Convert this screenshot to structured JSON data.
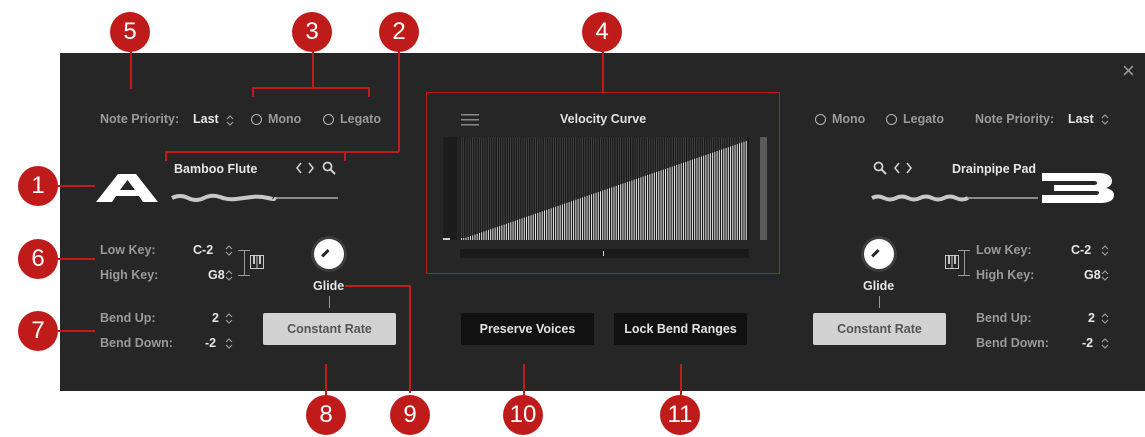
{
  "close_label": "×",
  "callouts": {
    "c1": "1",
    "c2": "2",
    "c3": "3",
    "c4": "4",
    "c5": "5",
    "c6": "6",
    "c7": "7",
    "c8": "8",
    "c9": "9",
    "c10": "10",
    "c11": "11"
  },
  "left": {
    "letter": "A",
    "note_priority_label": "Note Priority:",
    "note_priority_value": "Last",
    "mono_label": "Mono",
    "legato_label": "Legato",
    "sound_name": "Bamboo Flute",
    "low_key_label": "Low Key:",
    "low_key_value": "C-2",
    "high_key_label": "High Key:",
    "high_key_value": "G8",
    "bend_up_label": "Bend Up:",
    "bend_up_value": "2",
    "bend_down_label": "Bend Down:",
    "bend_down_value": "-2",
    "glide_label": "Glide",
    "constant_rate_label": "Constant Rate"
  },
  "right": {
    "letter": "B",
    "note_priority_label": "Note Priority:",
    "note_priority_value": "Last",
    "mono_label": "Mono",
    "legato_label": "Legato",
    "sound_name": "Drainpipe Pad",
    "low_key_label": "Low Key:",
    "low_key_value": "C-2",
    "high_key_label": "High Key:",
    "high_key_value": "G8",
    "bend_up_label": "Bend Up:",
    "bend_up_value": "2",
    "bend_down_label": "Bend Down:",
    "bend_down_value": "-2",
    "glide_label": "Glide",
    "constant_rate_label": "Constant Rate"
  },
  "center": {
    "velocity_curve_title": "Velocity Curve",
    "preserve_voices_label": "Preserve Voices",
    "lock_bend_ranges_label": "Lock Bend Ranges"
  },
  "icons": {
    "updown": "⌃⌄",
    "prev_next": "<>",
    "search": "search-icon",
    "keyboard": "keyboard-icon",
    "menu": "hamburger-menu-icon"
  },
  "colors": {
    "panel": "#262626",
    "callout": "#c01b1b",
    "accent_text": "#e6e6e6"
  }
}
